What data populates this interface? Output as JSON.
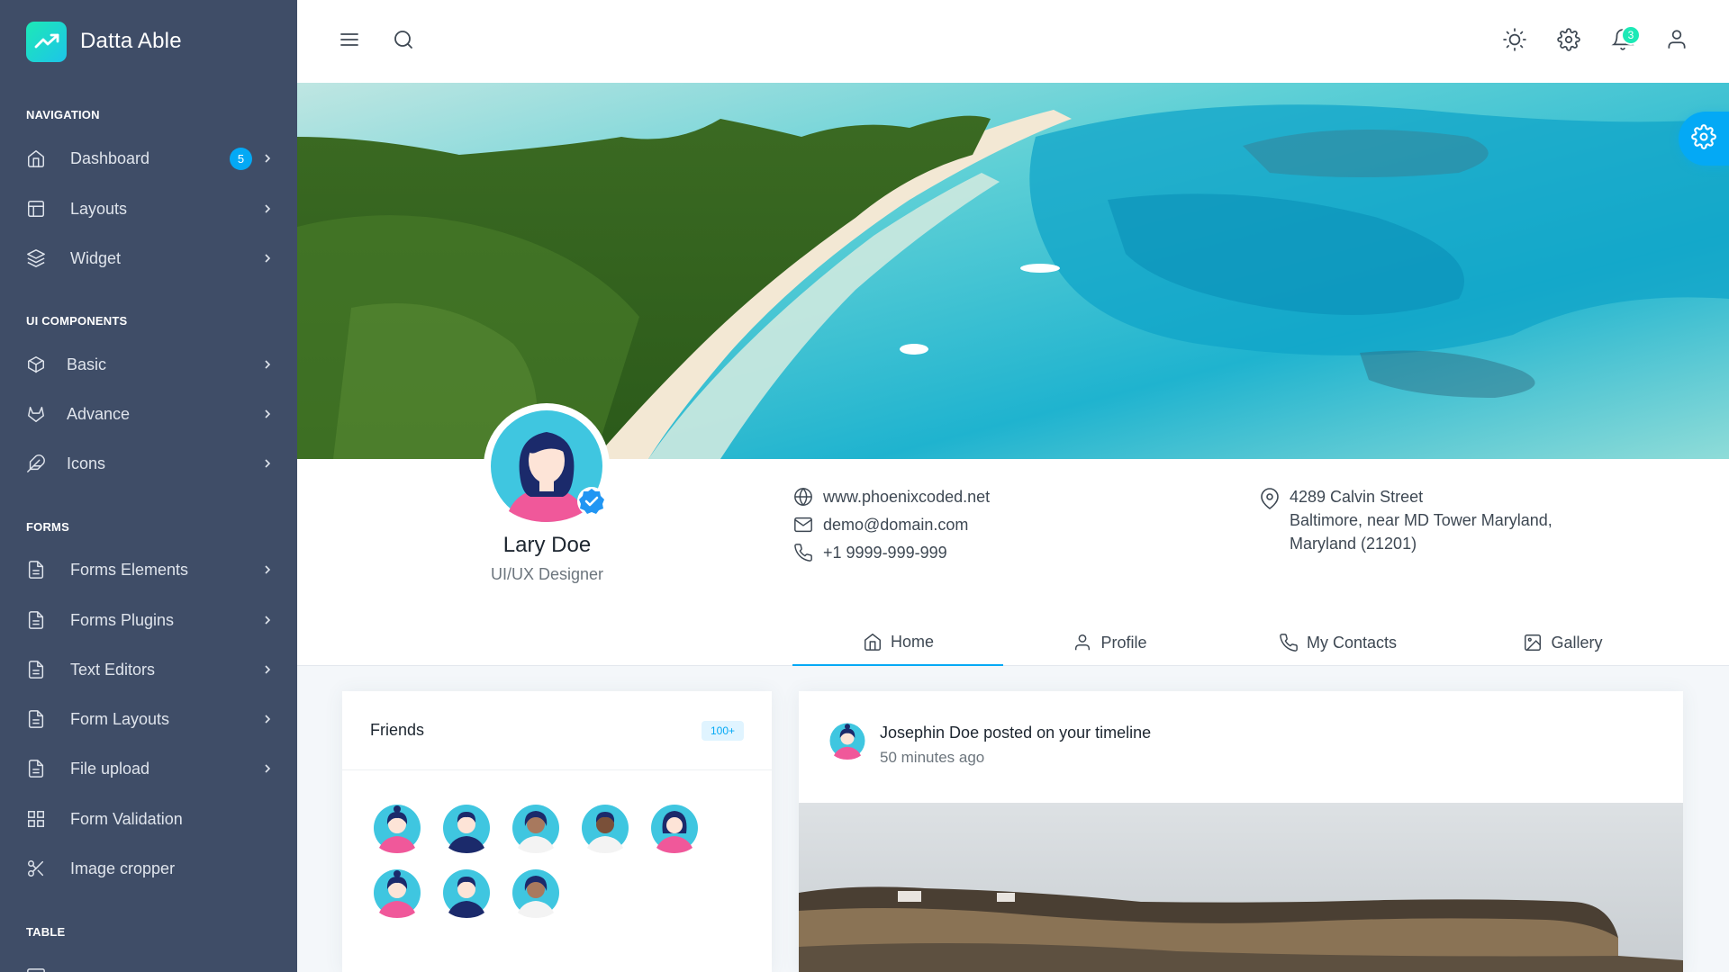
{
  "brand": {
    "name": "Datta Able",
    "accent": "#04a9f5",
    "gradient": [
      "#1de9b6",
      "#1dc4e9"
    ]
  },
  "sidebar": {
    "background": "#3f4d67",
    "sections": [
      {
        "caption": "NAVIGATION"
      },
      {
        "caption": "UI COMPONENTS"
      },
      {
        "caption": "FORMS"
      },
      {
        "caption": "TABLE"
      }
    ],
    "items": [
      {
        "label": "Dashboard",
        "icon": "home-icon",
        "badge": "5"
      },
      {
        "label": "Layouts",
        "icon": "layout-icon"
      },
      {
        "label": "Widget",
        "icon": "layers-icon"
      },
      {
        "label": "Basic",
        "icon": "box-icon"
      },
      {
        "label": "Advance",
        "icon": "gitlab-icon"
      },
      {
        "label": "Icons",
        "icon": "feather-icon"
      },
      {
        "label": "Forms Elements",
        "icon": "file-text-icon"
      },
      {
        "label": "Forms Plugins",
        "icon": "file-text-icon"
      },
      {
        "label": "Text Editors",
        "icon": "file-text-icon"
      },
      {
        "label": "Form Layouts",
        "icon": "file-text-icon"
      },
      {
        "label": "File upload",
        "icon": "file-text-icon"
      },
      {
        "label": "Form Validation",
        "icon": "grid-icon"
      },
      {
        "label": "Image cropper",
        "icon": "scissors-icon"
      }
    ]
  },
  "header": {
    "icons": [
      "menu-icon",
      "search-icon",
      "sun-icon",
      "settings-icon",
      "bell-icon",
      "user-icon"
    ],
    "notification_count": "3"
  },
  "profile": {
    "name": "Lary Doe",
    "role": "UI/UX Designer",
    "website": "www.phoenixcoded.net",
    "email": "demo@domain.com",
    "phone": "+1 9999-999-999",
    "address_lines": [
      "4289 Calvin Street",
      "Baltimore, near MD Tower Maryland,",
      "Maryland (21201)"
    ]
  },
  "tabs": [
    {
      "label": "Home",
      "icon": "home-icon",
      "active": true
    },
    {
      "label": "Profile",
      "icon": "user-icon",
      "active": false
    },
    {
      "label": "My Contacts",
      "icon": "phone-icon",
      "active": false
    },
    {
      "label": "Gallery",
      "icon": "image-icon",
      "active": false
    }
  ],
  "friends": {
    "title": "Friends",
    "badge": "100+"
  },
  "post": {
    "title": "Josephin Doe posted on your timeline",
    "time": "50 minutes ago"
  }
}
